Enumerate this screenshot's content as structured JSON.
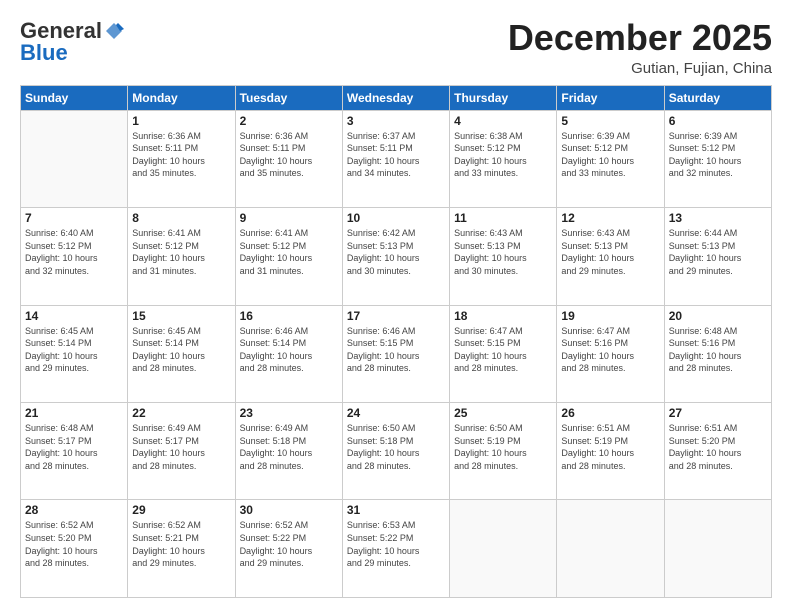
{
  "logo": {
    "general": "General",
    "blue": "Blue"
  },
  "header": {
    "month_year": "December 2025",
    "location": "Gutian, Fujian, China"
  },
  "weekdays": [
    "Sunday",
    "Monday",
    "Tuesday",
    "Wednesday",
    "Thursday",
    "Friday",
    "Saturday"
  ],
  "weeks": [
    [
      {
        "day": "",
        "info": ""
      },
      {
        "day": "1",
        "info": "Sunrise: 6:36 AM\nSunset: 5:11 PM\nDaylight: 10 hours\nand 35 minutes."
      },
      {
        "day": "2",
        "info": "Sunrise: 6:36 AM\nSunset: 5:11 PM\nDaylight: 10 hours\nand 35 minutes."
      },
      {
        "day": "3",
        "info": "Sunrise: 6:37 AM\nSunset: 5:11 PM\nDaylight: 10 hours\nand 34 minutes."
      },
      {
        "day": "4",
        "info": "Sunrise: 6:38 AM\nSunset: 5:12 PM\nDaylight: 10 hours\nand 33 minutes."
      },
      {
        "day": "5",
        "info": "Sunrise: 6:39 AM\nSunset: 5:12 PM\nDaylight: 10 hours\nand 33 minutes."
      },
      {
        "day": "6",
        "info": "Sunrise: 6:39 AM\nSunset: 5:12 PM\nDaylight: 10 hours\nand 32 minutes."
      }
    ],
    [
      {
        "day": "7",
        "info": "Sunrise: 6:40 AM\nSunset: 5:12 PM\nDaylight: 10 hours\nand 32 minutes."
      },
      {
        "day": "8",
        "info": "Sunrise: 6:41 AM\nSunset: 5:12 PM\nDaylight: 10 hours\nand 31 minutes."
      },
      {
        "day": "9",
        "info": "Sunrise: 6:41 AM\nSunset: 5:12 PM\nDaylight: 10 hours\nand 31 minutes."
      },
      {
        "day": "10",
        "info": "Sunrise: 6:42 AM\nSunset: 5:13 PM\nDaylight: 10 hours\nand 30 minutes."
      },
      {
        "day": "11",
        "info": "Sunrise: 6:43 AM\nSunset: 5:13 PM\nDaylight: 10 hours\nand 30 minutes."
      },
      {
        "day": "12",
        "info": "Sunrise: 6:43 AM\nSunset: 5:13 PM\nDaylight: 10 hours\nand 29 minutes."
      },
      {
        "day": "13",
        "info": "Sunrise: 6:44 AM\nSunset: 5:13 PM\nDaylight: 10 hours\nand 29 minutes."
      }
    ],
    [
      {
        "day": "14",
        "info": "Sunrise: 6:45 AM\nSunset: 5:14 PM\nDaylight: 10 hours\nand 29 minutes."
      },
      {
        "day": "15",
        "info": "Sunrise: 6:45 AM\nSunset: 5:14 PM\nDaylight: 10 hours\nand 28 minutes."
      },
      {
        "day": "16",
        "info": "Sunrise: 6:46 AM\nSunset: 5:14 PM\nDaylight: 10 hours\nand 28 minutes."
      },
      {
        "day": "17",
        "info": "Sunrise: 6:46 AM\nSunset: 5:15 PM\nDaylight: 10 hours\nand 28 minutes."
      },
      {
        "day": "18",
        "info": "Sunrise: 6:47 AM\nSunset: 5:15 PM\nDaylight: 10 hours\nand 28 minutes."
      },
      {
        "day": "19",
        "info": "Sunrise: 6:47 AM\nSunset: 5:16 PM\nDaylight: 10 hours\nand 28 minutes."
      },
      {
        "day": "20",
        "info": "Sunrise: 6:48 AM\nSunset: 5:16 PM\nDaylight: 10 hours\nand 28 minutes."
      }
    ],
    [
      {
        "day": "21",
        "info": "Sunrise: 6:48 AM\nSunset: 5:17 PM\nDaylight: 10 hours\nand 28 minutes."
      },
      {
        "day": "22",
        "info": "Sunrise: 6:49 AM\nSunset: 5:17 PM\nDaylight: 10 hours\nand 28 minutes."
      },
      {
        "day": "23",
        "info": "Sunrise: 6:49 AM\nSunset: 5:18 PM\nDaylight: 10 hours\nand 28 minutes."
      },
      {
        "day": "24",
        "info": "Sunrise: 6:50 AM\nSunset: 5:18 PM\nDaylight: 10 hours\nand 28 minutes."
      },
      {
        "day": "25",
        "info": "Sunrise: 6:50 AM\nSunset: 5:19 PM\nDaylight: 10 hours\nand 28 minutes."
      },
      {
        "day": "26",
        "info": "Sunrise: 6:51 AM\nSunset: 5:19 PM\nDaylight: 10 hours\nand 28 minutes."
      },
      {
        "day": "27",
        "info": "Sunrise: 6:51 AM\nSunset: 5:20 PM\nDaylight: 10 hours\nand 28 minutes."
      }
    ],
    [
      {
        "day": "28",
        "info": "Sunrise: 6:52 AM\nSunset: 5:20 PM\nDaylight: 10 hours\nand 28 minutes."
      },
      {
        "day": "29",
        "info": "Sunrise: 6:52 AM\nSunset: 5:21 PM\nDaylight: 10 hours\nand 29 minutes."
      },
      {
        "day": "30",
        "info": "Sunrise: 6:52 AM\nSunset: 5:22 PM\nDaylight: 10 hours\nand 29 minutes."
      },
      {
        "day": "31",
        "info": "Sunrise: 6:53 AM\nSunset: 5:22 PM\nDaylight: 10 hours\nand 29 minutes."
      },
      {
        "day": "",
        "info": ""
      },
      {
        "day": "",
        "info": ""
      },
      {
        "day": "",
        "info": ""
      }
    ]
  ]
}
